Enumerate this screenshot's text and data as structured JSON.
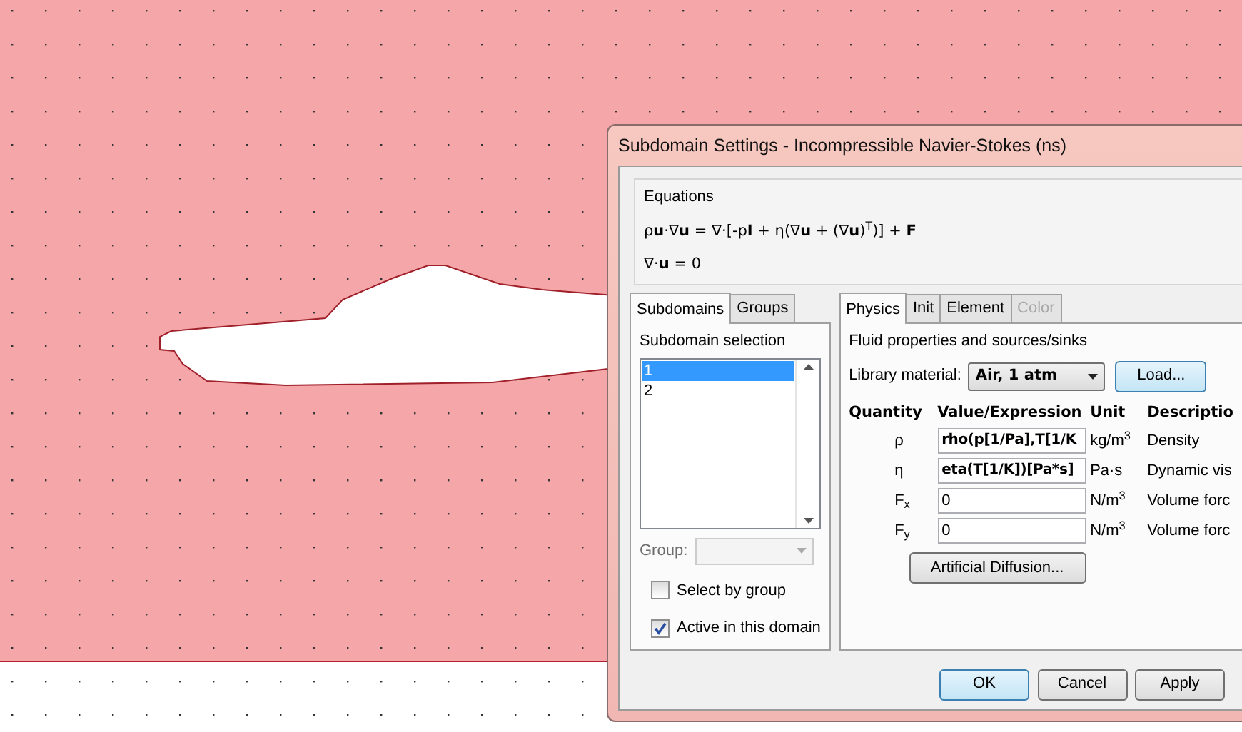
{
  "window": {
    "title": "Subdomain Settings - Incompressible Navier-Stokes (ns)"
  },
  "equations": {
    "title": "Equations",
    "lines": [
      "ρ**u**·∇**u** = ∇·[-p**I** + η(∇**u** + (∇**u**)$^{T}$)] + **F**",
      "∇·**u** = 0"
    ]
  },
  "left_tabs": [
    {
      "label": "Subdomains",
      "selected": true
    },
    {
      "label": "Groups",
      "selected": false
    }
  ],
  "subdomain_selection": {
    "title": "Subdomain selection",
    "items": [
      {
        "label": "1",
        "selected": true
      },
      {
        "label": "2",
        "selected": false
      }
    ],
    "group": {
      "label": "Group:",
      "disabled": true
    },
    "checkboxes": [
      {
        "label": "Select by group",
        "checked": false
      },
      {
        "label": "Active in this domain",
        "checked": true
      }
    ]
  },
  "right_tabs": [
    {
      "label": "Physics",
      "selected": true,
      "disabled": false
    },
    {
      "label": "Init",
      "selected": false,
      "disabled": false
    },
    {
      "label": "Element",
      "selected": false,
      "disabled": false
    },
    {
      "label": "Color",
      "selected": false,
      "disabled": true
    }
  ],
  "fluid": {
    "title": "Fluid properties and sources/sinks",
    "library_label": "Library material:",
    "library_value": "Air, 1 atm",
    "load_button": "Load...",
    "columns": [
      "Quantity",
      "Value/Expression",
      "Unit",
      "Descriptio"
    ],
    "rows": [
      {
        "quantity": "ρ",
        "value": "rho(p[1/Pa],T[1/K",
        "kind": "expression",
        "unit": "kg/m$^{3}$",
        "description": "Density"
      },
      {
        "quantity": "η",
        "value": "eta(T[1/K])[Pa*s]",
        "kind": "expression",
        "unit": "Pa·s",
        "description": "Dynamic vis"
      },
      {
        "quantity": "F$_{x}$",
        "value": "0",
        "kind": "number",
        "unit": "N/m$^{3}$",
        "description": "Volume forc"
      },
      {
        "quantity": "F$_{y}$",
        "value": "0",
        "kind": "number",
        "unit": "N/m$^{3}$",
        "description": "Volume forc"
      }
    ],
    "artificial_button": "Artificial Diffusion..."
  },
  "buttons": [
    {
      "label": "OK",
      "default": true
    },
    {
      "label": "Cancel",
      "default": false
    },
    {
      "label": "Apply",
      "default": false
    }
  ]
}
